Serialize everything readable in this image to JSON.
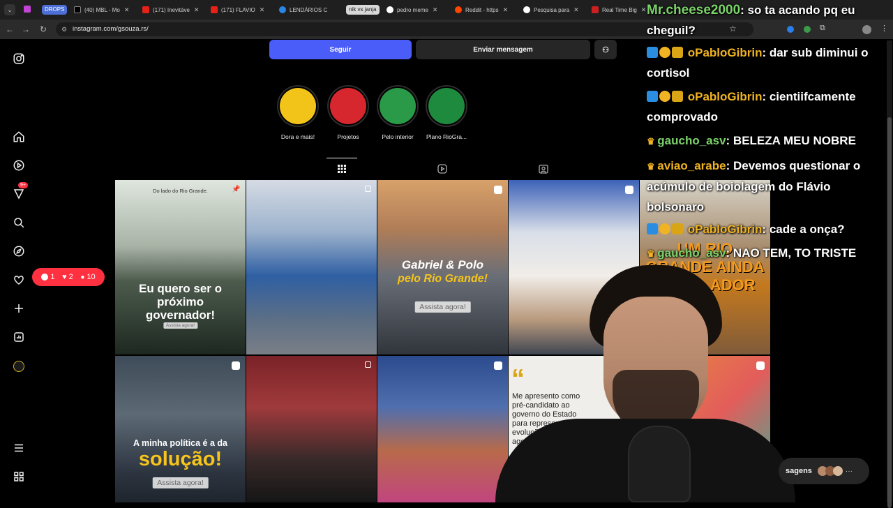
{
  "browser": {
    "tab_groups": [
      "DROPS",
      "nik vs janja"
    ],
    "tabs": [
      {
        "label": "(40) MBL - Mo"
      },
      {
        "label": "(171) Inevitáve"
      },
      {
        "label": "(171) FLAVIO"
      },
      {
        "label": "LENDÁRIOS C"
      },
      {
        "label": "pedro meme"
      },
      {
        "label": "Reddit - https"
      },
      {
        "label": "Pesquisa para"
      },
      {
        "label": "Real Time Big"
      }
    ],
    "url": "instagram.com/gsouza.rs/"
  },
  "profile": {
    "follow_label": "Seguir",
    "message_label": "Enviar mensagem",
    "highlights": [
      {
        "label": "Dora e mais!",
        "color": "#f2c318"
      },
      {
        "label": "Projetos",
        "color": "#d6262e"
      },
      {
        "label": "Pelo interior",
        "color": "#2a9a48"
      },
      {
        "label": "Plano RioGra...",
        "color": "#1e8a3e"
      }
    ]
  },
  "notifications": {
    "comments": "1",
    "likes": "2",
    "followers": "10",
    "more_badge": "9+"
  },
  "posts": {
    "p1_top": "Do lado do Rio Grande.",
    "p1_main": "Eu quero ser o próximo governador!",
    "p1_pill": "Assista agora!",
    "p3_main": "Gabriel & Polo",
    "p3_sub": "pelo Rio Grande!",
    "p3_pill": "Assista agora!",
    "p5_main": "UM RIO GRANDE AINDA MAIS ...ADOR",
    "p6_main": "A minha política é a da",
    "p6_sub": "solução!",
    "p6_pill": "Assista agora!",
    "p9_quote": "Me apresento como pré-candidato ao governo do Estado para representar a evolução dest... agend... que..."
  },
  "chat": [
    {
      "user": "Mr.cheese2000",
      "text": ": so ta acando pq eu cheguil?"
    },
    {
      "user": "oPabloGibrin",
      "text": ": dar sub diminui o cortisol"
    },
    {
      "user": "oPabloGibrin",
      "text": ": cientiifcamente comprovado"
    },
    {
      "user": "gaucho_asv",
      "text": ": BELEZA MEU NOBRE"
    },
    {
      "user": "aviao_arabe",
      "text": ": Devemos questionar o acúmulo de boiolagem do Flávio bolsonaro"
    },
    {
      "user": "oPabloGibrin",
      "text": ": cade a onça?"
    },
    {
      "user": "gaucho_asv",
      "text": ": NAO TEM, TO TRISTE"
    }
  ],
  "messages_button": "sagens"
}
